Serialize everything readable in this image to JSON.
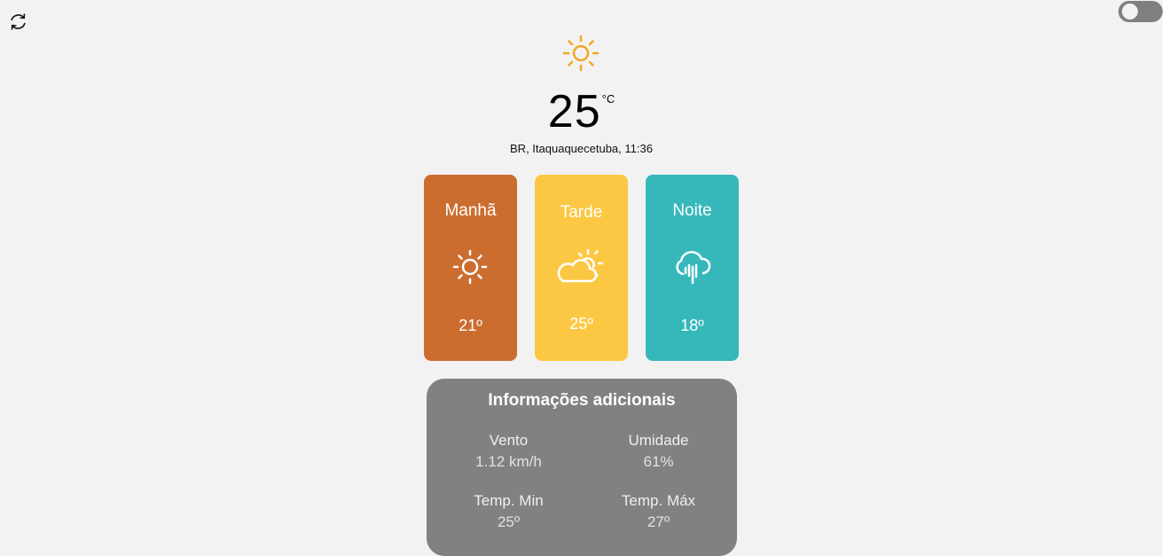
{
  "current": {
    "icon": "sun-icon",
    "temperature": "25",
    "unit": "°C",
    "location": "BR,  Itaquaquecetuba, 11:36"
  },
  "periods": [
    {
      "label": "Manhã",
      "icon": "sun-icon",
      "temp": "21º",
      "color": "#cc6d30"
    },
    {
      "label": "Tarde",
      "icon": "partly-cloudy-icon",
      "temp": "25º",
      "color": "#fcc843"
    },
    {
      "label": "Noite",
      "icon": "rain-cloud-icon",
      "temp": "18º",
      "color": "#36b8bb"
    }
  ],
  "info": {
    "title": "Informações adicionais",
    "wind_label": "Vento",
    "wind_value": "1.12 km/h",
    "humidity_label": "Umidade",
    "humidity_value": "61%",
    "min_label": "Temp. Min",
    "min_value": "25º",
    "max_label": "Temp. Máx",
    "max_value": "27º"
  },
  "controls": {
    "refresh_icon": "refresh-icon",
    "theme_toggle": "off"
  }
}
